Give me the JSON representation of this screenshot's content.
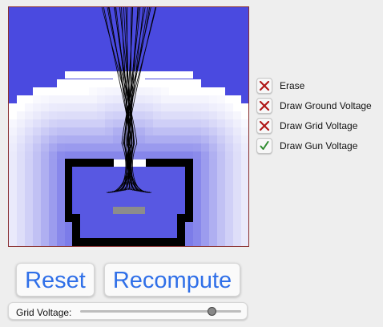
{
  "options": [
    {
      "label": "Erase",
      "checked": false
    },
    {
      "label": "Draw Ground Voltage",
      "checked": false
    },
    {
      "label": "Draw Grid Voltage",
      "checked": false
    },
    {
      "label": "Draw Gun Voltage",
      "checked": true
    }
  ],
  "buttons": {
    "reset_label": "Reset",
    "recompute_label": "Recompute"
  },
  "slider": {
    "label": "Grid Voltage:",
    "value_fraction": 0.82
  },
  "colors": {
    "accent": "#2f6fe8",
    "field_blue": "#4a4ae0",
    "cross_red": "#b01818",
    "check_green": "#2e8b2e",
    "canvas_border": "#8a3030"
  }
}
